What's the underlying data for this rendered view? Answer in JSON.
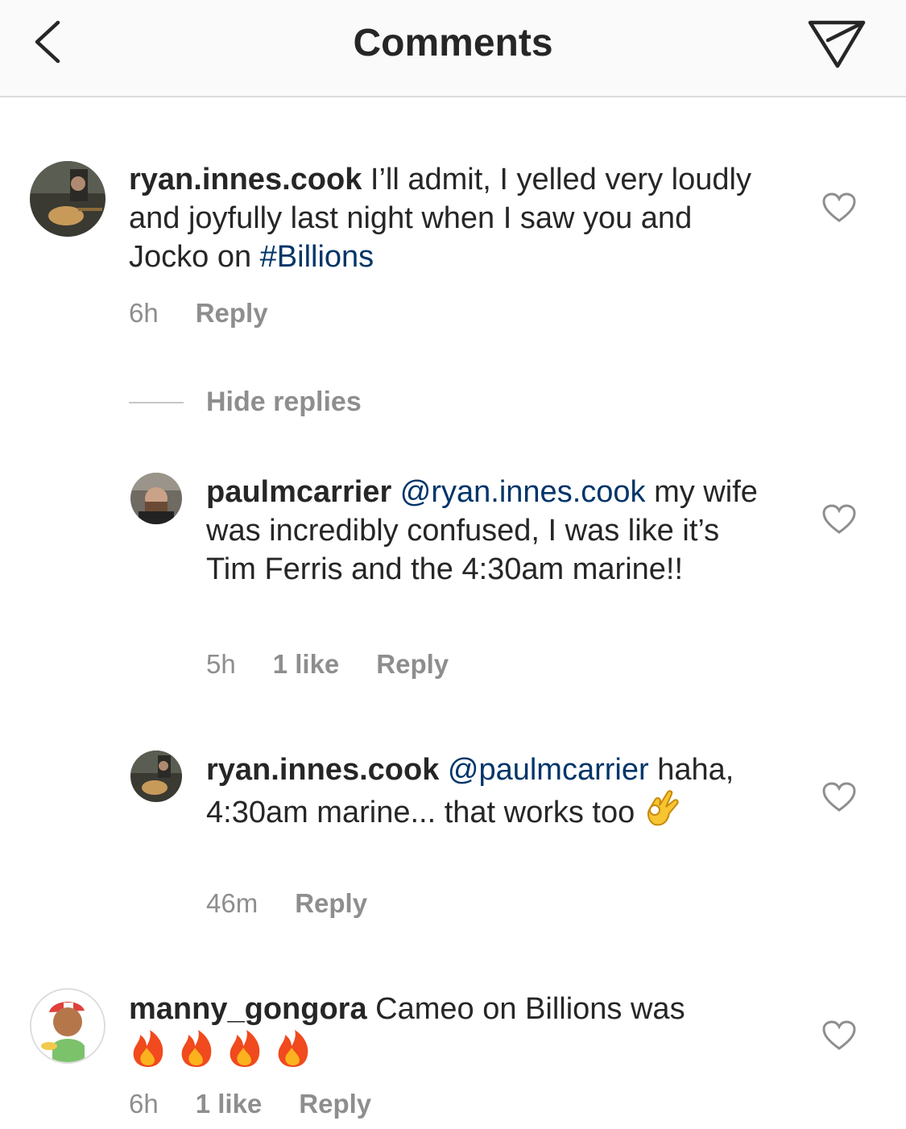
{
  "header": {
    "title": "Comments"
  },
  "comments": [
    {
      "username": "ryan.innes.cook",
      "text_before": "I’ll admit, I yelled very loudly and joyfully last night when I saw you and Jocko on ",
      "hashtag": "#Billions",
      "time": "6h",
      "reply_label": "Reply"
    },
    {
      "username": "paulmcarrier",
      "mention": "@ryan.innes.cook",
      "text": "my wife was incredibly confused, I was like it’s Tim Ferris and the 4:30am marine!!",
      "time": "5h",
      "likes": "1 like",
      "reply_label": "Reply"
    },
    {
      "username": "ryan.innes.cook",
      "mention": "@paulmcarrier",
      "text": "haha, 4:30am marine... that works too",
      "emoji": "ok-hand-icon",
      "time": "46m",
      "reply_label": "Reply"
    },
    {
      "username": "manny_gongora",
      "text": "Cameo on Billions was",
      "emoji": "fire-icon x4",
      "time": "6h",
      "likes": "1 like",
      "reply_label": "Reply"
    }
  ],
  "replies_toggle": {
    "label": "Hide replies"
  },
  "colors": {
    "link": "#003569",
    "muted": "#8e8e8e",
    "text": "#262626",
    "header_bg": "#fafafa"
  }
}
